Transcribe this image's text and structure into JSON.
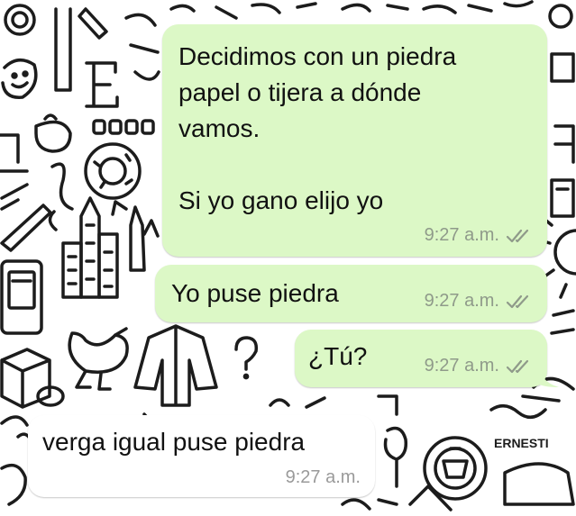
{
  "colors": {
    "outgoing_bubble": "#dcf8c6",
    "incoming_bubble": "#ffffff",
    "wallpaper": "#ffffff",
    "doodle_stroke": "#1c1c1c",
    "timestamp": "#8f9a8a",
    "read_ticks": "#8f9a8a"
  },
  "messages": [
    {
      "direction": "outgoing",
      "text": "Decidimos con un piedra\npapel o tijera a dónde\nvamos.\n\nSi yo gano elijo yo",
      "time": "9:27 a.m.",
      "status_icon": "double-check-icon"
    },
    {
      "direction": "outgoing",
      "text": "Yo puse piedra",
      "time": "9:27 a.m.",
      "status_icon": "double-check-icon"
    },
    {
      "direction": "outgoing",
      "text": "¿Tú?",
      "time": "9:27 a.m.",
      "status_icon": "double-check-icon"
    },
    {
      "direction": "incoming",
      "text": "verga igual puse piedra",
      "time": "9:27 a.m."
    }
  ]
}
